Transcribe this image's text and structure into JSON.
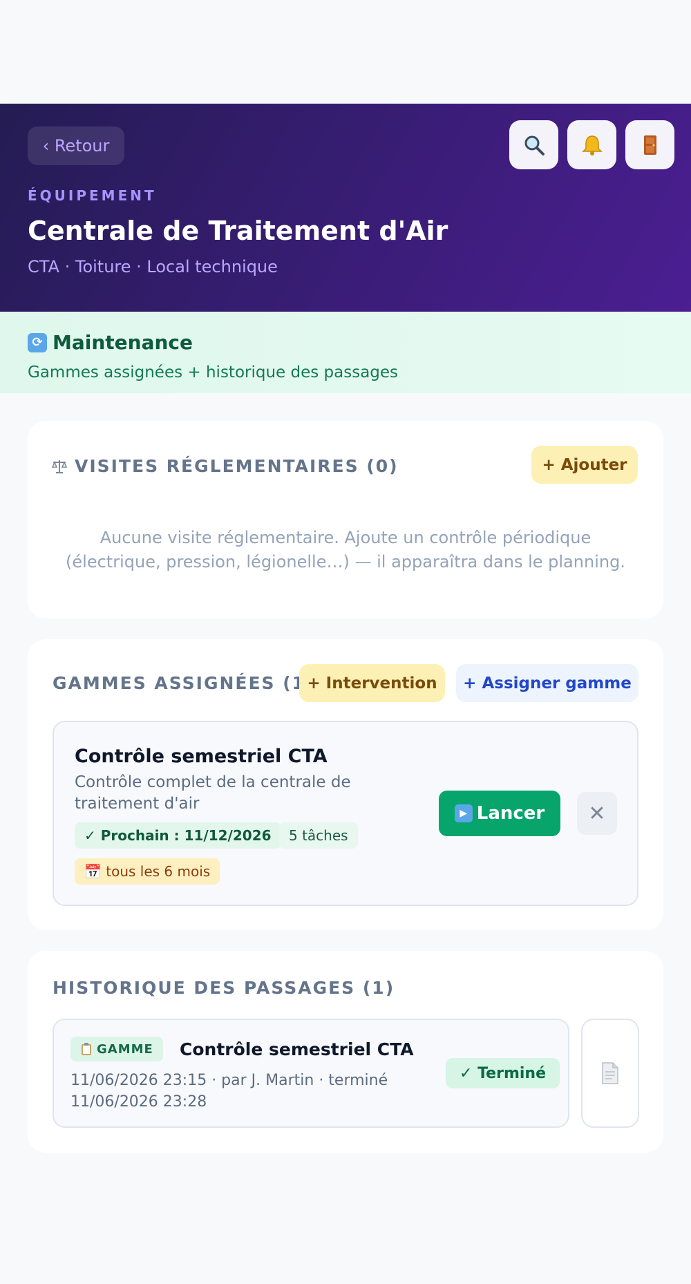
{
  "header": {
    "back_label": "‹ Retour",
    "overline": "ÉQUIPEMENT",
    "title": "Centrale de Traitement d'Air",
    "subtitle": "CTA · Toiture · Local technique",
    "icons": [
      "search-icon",
      "bell-icon",
      "door-icon"
    ]
  },
  "banner": {
    "emoji": "🔁",
    "title": "Maintenance",
    "subtitle": "Gammes assignées + historique des passages"
  },
  "visites": {
    "title": "VISITES RÉGLEMENTAIRES (0)",
    "add_label": "+ Ajouter",
    "empty_line1": "Aucune visite réglementaire. Ajoute un contrôle périodique",
    "empty_line2": "(électrique, pression, légionelle…) — il apparaîtra dans le planning."
  },
  "gammes": {
    "title": "GAMMES ASSIGNÉES (1)",
    "intervention_label": "+ Intervention",
    "assign_label": "+ Assigner gamme",
    "item": {
      "title": "Contrôle semestriel CTA",
      "desc_line1": "Contrôle complet de la centrale de",
      "desc_line2": "traitement d'air",
      "next_label": "✓ Prochain : 11/12/2026",
      "tasks_label": "5 tâches",
      "frequency_label": "📅 tous les 6 mois",
      "launch_label": "Lancer",
      "remove_glyph": "✕"
    }
  },
  "historique": {
    "title": "HISTORIQUE DES PASSAGES (1)",
    "item": {
      "tag_label": "GAMME",
      "title": "Contrôle semestriel CTA",
      "meta_line1": "11/06/2026 23:15 · par J. Martin · terminé",
      "meta_line2": "11/06/2026 23:28",
      "status_label": "✓ Terminé"
    }
  },
  "colors": {
    "header_gradient_start": "#241c53",
    "header_gradient_end": "#4b1e92",
    "accent_green": "#07a56c",
    "accent_yellow": "#fdf0b4",
    "accent_blue": "#2247c9"
  }
}
